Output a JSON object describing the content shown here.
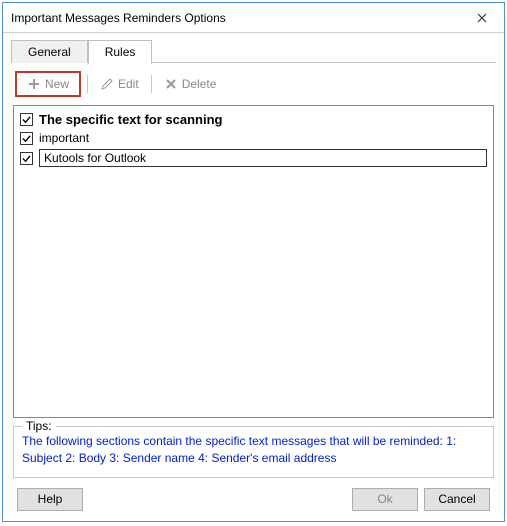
{
  "title": "Important Messages Reminders Options",
  "tabs": {
    "general": "General",
    "rules": "Rules"
  },
  "toolbar": {
    "new": "New",
    "edit": "Edit",
    "delete": "Delete"
  },
  "rules": {
    "header": "The specific text for scanning",
    "items": [
      {
        "checked": true,
        "text": "important",
        "boxed": false
      },
      {
        "checked": true,
        "text": "Kutools for Outlook",
        "boxed": true
      }
    ]
  },
  "tips": {
    "label": "Tips:",
    "text": "The following sections contain the specific text messages that will be reminded: 1: Subject 2: Body 3: Sender name 4: Sender's email address"
  },
  "buttons": {
    "help": "Help",
    "ok": "Ok",
    "cancel": "Cancel"
  }
}
